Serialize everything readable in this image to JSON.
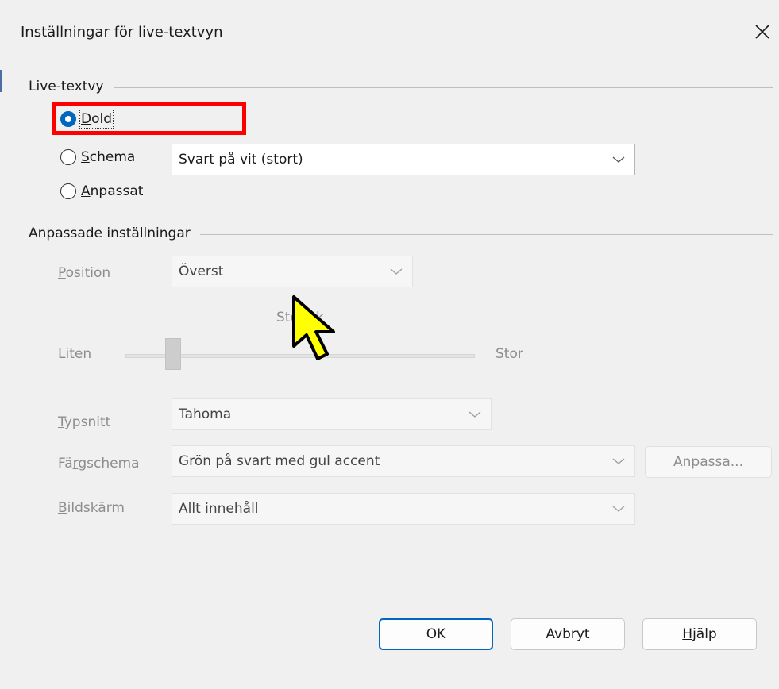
{
  "dialog": {
    "title": "Inställningar för live-textvyn",
    "close_icon": "close-icon"
  },
  "live_view_group": {
    "label": "Live-textvy",
    "options": [
      {
        "prefix": "",
        "accel": "D",
        "rest": "old",
        "checked": true
      },
      {
        "prefix": "",
        "accel": "S",
        "rest": "chema",
        "checked": false
      },
      {
        "prefix": "",
        "accel": "A",
        "rest": "npassat",
        "checked": false
      }
    ],
    "scheme_select": {
      "value": "Svart på vit (stort)"
    }
  },
  "custom_group": {
    "label": "Anpassade inställningar",
    "position": {
      "label": "Position",
      "value": "Överst"
    },
    "size": {
      "label": "Storlek",
      "min_label": "Liten",
      "max_label": "Stor",
      "level": 0.12
    },
    "font": {
      "label": "Typsnitt",
      "value": "Tahoma"
    },
    "color_scheme": {
      "label": "Färgschema",
      "value": "Grön på svart med gul accent",
      "customize_button": "Anpassa..."
    },
    "display": {
      "label": "Bildskärm",
      "value": "Allt innehåll"
    }
  },
  "buttons": {
    "ok": "OK",
    "cancel": "Avbryt",
    "help_accel": "H",
    "help_rest": "jälp"
  },
  "colors": {
    "accent": "#0067c0",
    "highlight": "#ff0000",
    "cursor": "#ffff00"
  }
}
